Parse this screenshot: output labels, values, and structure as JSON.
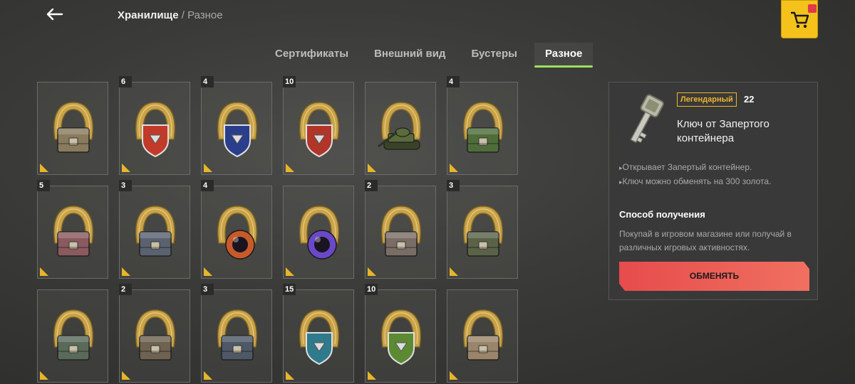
{
  "header": {
    "breadcrumb_main": "Хранилище",
    "breadcrumb_sep": "/",
    "breadcrumb_sub": "Разное"
  },
  "tabs": [
    {
      "label": "Сертификаты",
      "active": false
    },
    {
      "label": "Внешний вид",
      "active": false
    },
    {
      "label": "Бустеры",
      "active": false
    },
    {
      "label": "Разное",
      "active": true
    }
  ],
  "items": [
    {
      "count": "",
      "kind": "crate",
      "color": "#8a7b5e"
    },
    {
      "count": "6",
      "kind": "shield",
      "color": "#c23a2a"
    },
    {
      "count": "4",
      "kind": "shield",
      "color": "#2a3e8c"
    },
    {
      "count": "10",
      "kind": "shield",
      "color": "#b2352a"
    },
    {
      "count": "",
      "kind": "tank",
      "color": "#5b6b3c"
    },
    {
      "count": "4",
      "kind": "crate",
      "color": "#4f6d3a"
    },
    {
      "count": "5",
      "kind": "crate",
      "color": "#8a5a5e"
    },
    {
      "count": "3",
      "kind": "crate",
      "color": "#5a6270"
    },
    {
      "count": "4",
      "kind": "orb",
      "color": "#c85a2a"
    },
    {
      "count": "",
      "kind": "orb",
      "color": "#6a48c8"
    },
    {
      "count": "2",
      "kind": "crate",
      "color": "#7a6d66"
    },
    {
      "count": "3",
      "kind": "crate",
      "color": "#5a6248"
    },
    {
      "count": "",
      "kind": "crate",
      "color": "#5a6a5a"
    },
    {
      "count": "2",
      "kind": "crate",
      "color": "#6e6250"
    },
    {
      "count": "3",
      "kind": "crate",
      "color": "#4e5866"
    },
    {
      "count": "15",
      "kind": "shield",
      "color": "#2f7a8c"
    },
    {
      "count": "10",
      "kind": "shield",
      "color": "#5c8a32"
    },
    {
      "count": "",
      "kind": "crate",
      "color": "#9a846a"
    }
  ],
  "detail": {
    "rarity": "Легендарный",
    "quantity": "22",
    "title": "Ключ от Запертого контейнера",
    "bullets": [
      "Открывает Запертый контейнер.",
      "Ключ можно обменять на 300 золота."
    ],
    "how_to_get_title": "Способ получения",
    "how_to_get_text": "Покупай в игровом магазине или получай в различных игровых активностях.",
    "exchange_label": "ОБМЕНЯТЬ"
  },
  "colors": {
    "accent_tab": "#9be25a",
    "rarity_gold": "#f0b428",
    "exchange_red": "#e64c4c",
    "cart_yellow": "#f4c21b"
  }
}
